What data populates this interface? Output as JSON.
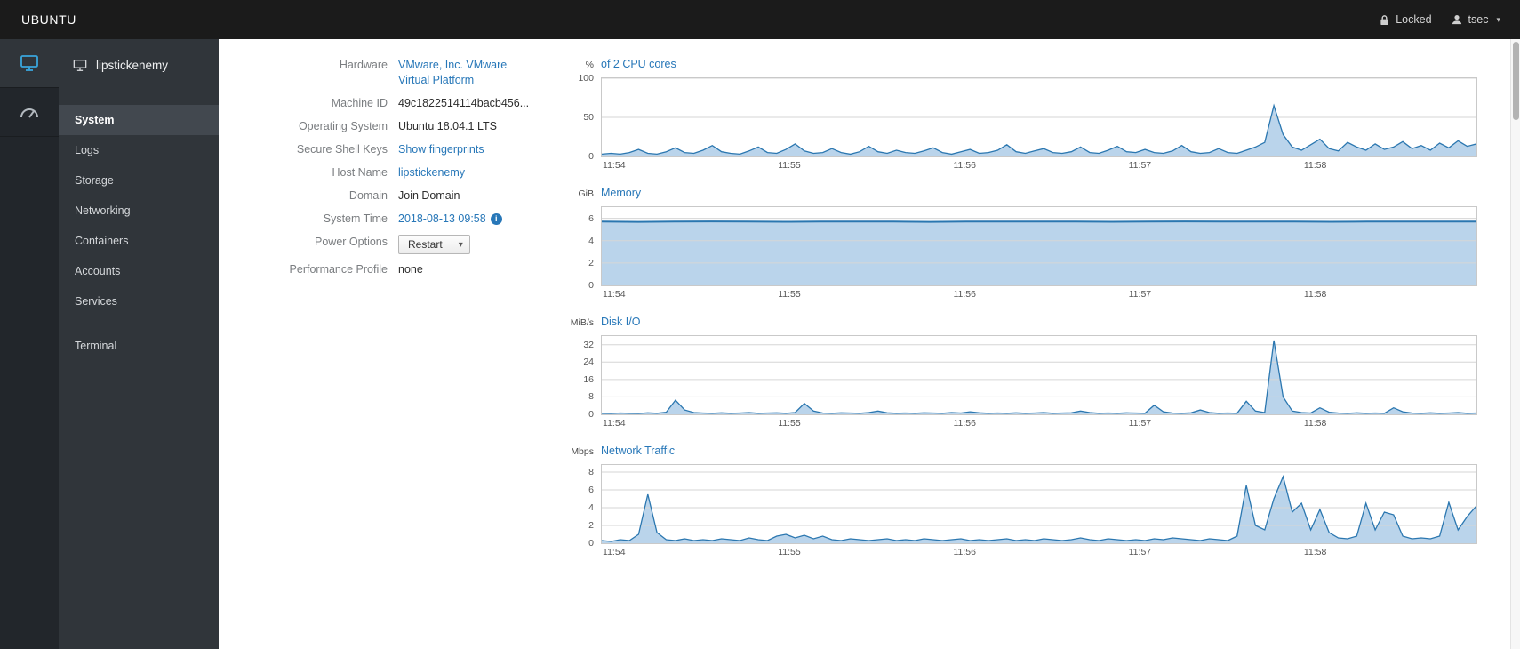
{
  "masthead": {
    "brand": "UBUNTU",
    "locked_label": "Locked",
    "user_name": "tsec"
  },
  "sidebar": {
    "hostname": "lipstickenemy",
    "active_item": "System",
    "items": [
      {
        "label": "System"
      },
      {
        "label": "Logs"
      },
      {
        "label": "Storage"
      },
      {
        "label": "Networking"
      },
      {
        "label": "Containers"
      },
      {
        "label": "Accounts"
      },
      {
        "label": "Services"
      },
      {
        "label": "Terminal"
      }
    ]
  },
  "system_info": {
    "rows": [
      {
        "label": "Hardware",
        "value": "VMware, Inc. VMware Virtual Platform"
      },
      {
        "label": "Machine ID",
        "value": "49c1822514114bacb456..."
      },
      {
        "label": "Operating System",
        "value": "Ubuntu 18.04.1 LTS"
      },
      {
        "label": "Secure Shell Keys",
        "value": "Show fingerprints"
      },
      {
        "label": "Host Name",
        "value": "lipstickenemy"
      },
      {
        "label": "Domain",
        "value": "Join Domain"
      },
      {
        "label": "System Time",
        "value": "2018-08-13 09:58"
      },
      {
        "label": "Power Options",
        "value": "Restart"
      },
      {
        "label": "Performance Profile",
        "value": "none"
      }
    ],
    "info_icon_glyph": "i",
    "power_caret": "▾"
  },
  "colors": {
    "link": "#2777b8",
    "chart_line": "#2b77b0",
    "chart_fill": "#aecde8",
    "grid": "#d6d6d6",
    "masthead_bg": "#1b1b1b",
    "sidebar_bg": "#30353a",
    "machine_icon_blue": "#39a5dc"
  },
  "chart_data": [
    {
      "type": "area",
      "unit": "%",
      "title": "of 2 CPU cores",
      "ymax": 100,
      "yticks": [
        0,
        50,
        100
      ],
      "xticks": [
        "11:54",
        "11:55",
        "11:56",
        "11:57",
        "11:58"
      ],
      "xtick_pos": [
        0.015,
        0.215,
        0.415,
        0.615,
        0.815
      ],
      "line_width": 1.3,
      "values": [
        3,
        4,
        3,
        5,
        9,
        4,
        3,
        6,
        11,
        5,
        4,
        8,
        14,
        6,
        4,
        3,
        7,
        12,
        5,
        4,
        9,
        16,
        7,
        4,
        5,
        10,
        5,
        3,
        6,
        13,
        6,
        4,
        8,
        5,
        4,
        7,
        11,
        5,
        3,
        6,
        9,
        4,
        5,
        8,
        15,
        6,
        4,
        7,
        10,
        5,
        4,
        6,
        12,
        5,
        4,
        8,
        13,
        6,
        5,
        9,
        5,
        4,
        7,
        14,
        6,
        4,
        5,
        10,
        5,
        4,
        8,
        12,
        18,
        65,
        28,
        12,
        8,
        15,
        22,
        10,
        7,
        18,
        12,
        8,
        16,
        9,
        12,
        19,
        10,
        14,
        8,
        17,
        11,
        20,
        13,
        16
      ]
    },
    {
      "type": "area",
      "unit": "GiB",
      "title": "Memory",
      "ymax": 7,
      "yticks": [
        0,
        2,
        4,
        6
      ],
      "xticks": [
        "11:54",
        "11:55",
        "11:56",
        "11:57",
        "11:58"
      ],
      "xtick_pos": [
        0.015,
        0.215,
        0.415,
        0.615,
        0.815
      ],
      "line_width": 2,
      "values": [
        5.7,
        5.68,
        5.7,
        5.72,
        5.7,
        5.69,
        5.71,
        5.7,
        5.7,
        5.68,
        5.7,
        5.71,
        5.7,
        5.7,
        5.69,
        5.7,
        5.72,
        5.7,
        5.7,
        5.7,
        5.69,
        5.7,
        5.71,
        5.7,
        5.7
      ]
    },
    {
      "type": "area",
      "unit": "MiB/s",
      "title": "Disk I/O",
      "ymax": 36,
      "yticks": [
        0,
        8,
        16,
        24,
        32
      ],
      "xticks": [
        "11:54",
        "11:55",
        "11:56",
        "11:57",
        "11:58"
      ],
      "xtick_pos": [
        0.015,
        0.215,
        0.415,
        0.615,
        0.815
      ],
      "line_width": 1.3,
      "values": [
        0.5,
        0.4,
        0.6,
        0.5,
        0.4,
        0.7,
        0.5,
        1.0,
        6.5,
        2.0,
        0.8,
        0.6,
        0.5,
        0.7,
        0.5,
        0.6,
        0.8,
        0.5,
        0.6,
        0.7,
        0.5,
        0.8,
        5.0,
        1.5,
        0.6,
        0.5,
        0.7,
        0.6,
        0.5,
        0.8,
        1.5,
        0.7,
        0.5,
        0.6,
        0.5,
        0.7,
        0.6,
        0.5,
        0.8,
        0.6,
        1.2,
        0.7,
        0.5,
        0.6,
        0.5,
        0.7,
        0.5,
        0.6,
        0.8,
        0.5,
        0.6,
        0.7,
        1.5,
        0.8,
        0.5,
        0.6,
        0.5,
        0.7,
        0.6,
        0.5,
        4.2,
        1.2,
        0.6,
        0.5,
        0.7,
        2.0,
        0.8,
        0.5,
        0.6,
        0.5,
        6.0,
        1.5,
        0.8,
        34,
        8.0,
        1.5,
        0.8,
        0.6,
        3.0,
        1.0,
        0.6,
        0.5,
        0.7,
        0.5,
        0.6,
        0.5,
        3.0,
        1.2,
        0.6,
        0.5,
        0.7,
        0.5,
        0.6,
        0.8,
        0.5,
        0.6
      ]
    },
    {
      "type": "area",
      "unit": "Mbps",
      "title": "Network Traffic",
      "ymax": 8.8,
      "yticks": [
        0,
        2,
        4,
        6,
        8
      ],
      "xticks": [
        "11:54",
        "11:55",
        "11:56",
        "11:57",
        "11:58"
      ],
      "xtick_pos": [
        0.015,
        0.215,
        0.415,
        0.615,
        0.815
      ],
      "line_width": 1.3,
      "values": [
        0.3,
        0.2,
        0.4,
        0.3,
        1.0,
        5.5,
        1.2,
        0.4,
        0.3,
        0.5,
        0.3,
        0.4,
        0.3,
        0.5,
        0.4,
        0.3,
        0.6,
        0.4,
        0.3,
        0.8,
        1.0,
        0.6,
        0.9,
        0.5,
        0.8,
        0.4,
        0.3,
        0.5,
        0.4,
        0.3,
        0.4,
        0.5,
        0.3,
        0.4,
        0.3,
        0.5,
        0.4,
        0.3,
        0.4,
        0.5,
        0.3,
        0.4,
        0.3,
        0.4,
        0.5,
        0.3,
        0.4,
        0.3,
        0.5,
        0.4,
        0.3,
        0.4,
        0.6,
        0.4,
        0.3,
        0.5,
        0.4,
        0.3,
        0.4,
        0.3,
        0.5,
        0.4,
        0.6,
        0.5,
        0.4,
        0.3,
        0.5,
        0.4,
        0.3,
        0.8,
        6.5,
        2.0,
        1.5,
        5.0,
        7.5,
        3.5,
        4.5,
        1.5,
        3.8,
        1.2,
        0.6,
        0.5,
        0.8,
        4.5,
        1.5,
        3.5,
        3.2,
        0.8,
        0.5,
        0.6,
        0.5,
        0.8,
        4.6,
        1.5,
        3.0,
        4.2
      ]
    }
  ]
}
